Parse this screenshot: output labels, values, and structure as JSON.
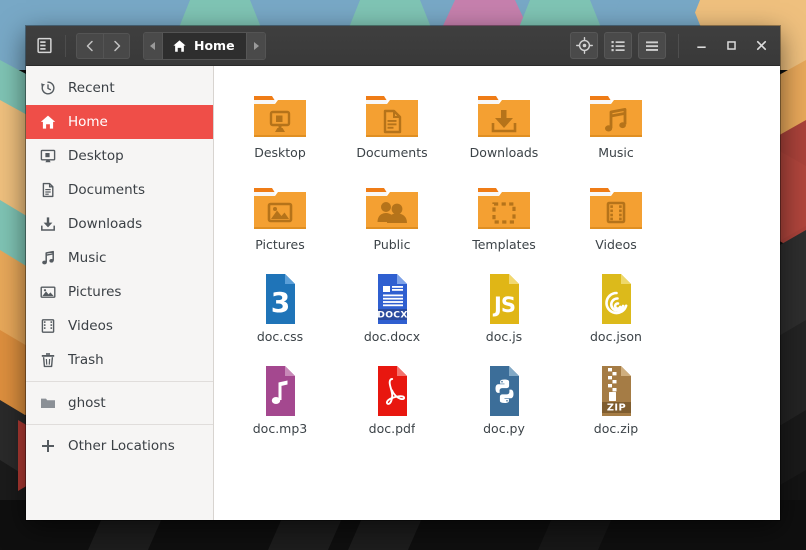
{
  "window": {
    "title": "Home",
    "headerbar": {
      "sidebar_toggle": "sidebar-toggle-icon",
      "back_label": "‹",
      "forward_label": "›",
      "path_prev": "◂",
      "path_next": "▸",
      "crumb_label": "Home",
      "crumb_icon": "home-icon",
      "location_button": "location-target-icon",
      "list_view_button": "list-view-icon",
      "menu_button": "hamburger-menu-icon",
      "minimize": "–",
      "maximize": "□",
      "close": "✕"
    },
    "colors": {
      "headerbar": "#3c3c3c",
      "sidebar": "#f6f5f4",
      "accent": "#ef4e48",
      "content": "#ffffff",
      "folder_body": "#f4a032",
      "folder_tab": "#ef7c16"
    }
  },
  "sidebar": {
    "groups": [
      {
        "items": [
          {
            "label": "Recent",
            "icon": "clock-history-icon",
            "active": false
          },
          {
            "label": "Home",
            "icon": "home-icon",
            "active": true
          },
          {
            "label": "Desktop",
            "icon": "desktop-icon",
            "active": false
          },
          {
            "label": "Documents",
            "icon": "document-icon",
            "active": false
          },
          {
            "label": "Downloads",
            "icon": "download-icon",
            "active": false
          },
          {
            "label": "Music",
            "icon": "music-note-icon",
            "active": false
          },
          {
            "label": "Pictures",
            "icon": "picture-icon",
            "active": false
          },
          {
            "label": "Videos",
            "icon": "film-icon",
            "active": false
          },
          {
            "label": "Trash",
            "icon": "trash-icon",
            "active": false
          }
        ]
      },
      {
        "items": [
          {
            "label": "ghost",
            "icon": "folder-icon",
            "active": false
          }
        ]
      },
      {
        "items": [
          {
            "label": "Other Locations",
            "icon": "plus-icon",
            "active": false
          }
        ]
      }
    ]
  },
  "files": [
    {
      "name": "Desktop",
      "type": "folder",
      "emblem": "desktop-icon"
    },
    {
      "name": "Documents",
      "type": "folder",
      "emblem": "document-icon"
    },
    {
      "name": "Downloads",
      "type": "folder",
      "emblem": "download-icon"
    },
    {
      "name": "Music",
      "type": "folder",
      "emblem": "music-note-icon"
    },
    {
      "name": "Pictures",
      "type": "folder",
      "emblem": "picture-icon"
    },
    {
      "name": "Public",
      "type": "folder",
      "emblem": "people-icon"
    },
    {
      "name": "Templates",
      "type": "folder",
      "emblem": "dashed-square-icon"
    },
    {
      "name": "Videos",
      "type": "folder",
      "emblem": "film-icon"
    },
    {
      "name": "doc.css",
      "type": "file",
      "emblem": "css3-icon",
      "color": "#1f74b8",
      "badge": ""
    },
    {
      "name": "doc.docx",
      "type": "file",
      "emblem": "docx-icon",
      "color": "#2f5fd0",
      "badge": "DOCX"
    },
    {
      "name": "doc.js",
      "type": "file",
      "emblem": "js-icon",
      "color": "#e0b616",
      "badge": ""
    },
    {
      "name": "doc.json",
      "type": "file",
      "emblem": "json-icon",
      "color": "#dcba1b",
      "badge": ""
    },
    {
      "name": "doc.mp3",
      "type": "file",
      "emblem": "note-icon",
      "color": "#a4488f",
      "badge": ""
    },
    {
      "name": "doc.pdf",
      "type": "file",
      "emblem": "acrobat-icon",
      "color": "#e8170f",
      "badge": ""
    },
    {
      "name": "doc.py",
      "type": "file",
      "emblem": "python-icon",
      "color": "#3c6e99",
      "badge": ""
    },
    {
      "name": "doc.zip",
      "type": "file",
      "emblem": "zipper-icon",
      "color": "#a57c45",
      "badge": "ZIP"
    }
  ]
}
